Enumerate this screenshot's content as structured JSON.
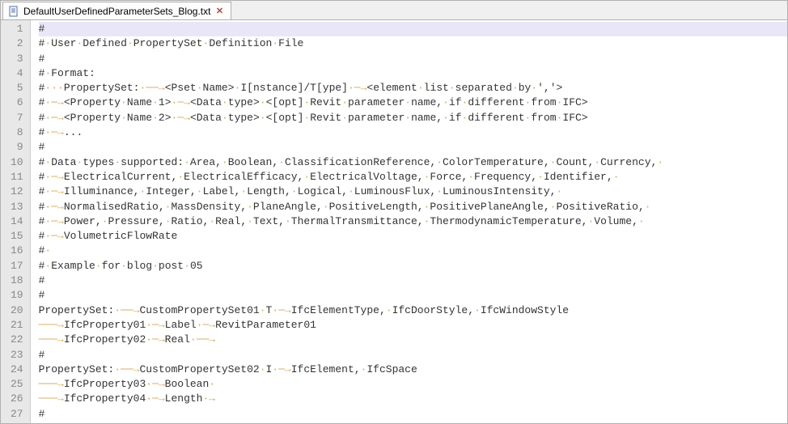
{
  "tab": {
    "filename": "DefaultUserDefinedParameterSets_Blog.txt"
  },
  "editor": {
    "current_line": 1,
    "tab_width_chars": 4,
    "lines": [
      [
        {
          "t": "text",
          "v": "#"
        }
      ],
      [
        {
          "t": "text",
          "v": "#"
        },
        {
          "t": "sp"
        },
        {
          "t": "text",
          "v": "User"
        },
        {
          "t": "sp"
        },
        {
          "t": "text",
          "v": "Defined"
        },
        {
          "t": "sp"
        },
        {
          "t": "text",
          "v": "PropertySet"
        },
        {
          "t": "sp"
        },
        {
          "t": "text",
          "v": "Definition"
        },
        {
          "t": "sp"
        },
        {
          "t": "text",
          "v": "File"
        }
      ],
      [
        {
          "t": "text",
          "v": "#"
        }
      ],
      [
        {
          "t": "text",
          "v": "#"
        },
        {
          "t": "sp"
        },
        {
          "t": "text",
          "v": "Format:"
        }
      ],
      [
        {
          "t": "text",
          "v": "#"
        },
        {
          "t": "sp"
        },
        {
          "t": "sp"
        },
        {
          "t": "sp"
        },
        {
          "t": "text",
          "v": "PropertySet:"
        },
        {
          "t": "sp"
        },
        {
          "t": "tab"
        },
        {
          "t": "text",
          "v": "<Pset"
        },
        {
          "t": "sp"
        },
        {
          "t": "text",
          "v": "Name>"
        },
        {
          "t": "sp"
        },
        {
          "t": "text",
          "v": "I[nstance]/T[ype]"
        },
        {
          "t": "sp"
        },
        {
          "t": "tab"
        },
        {
          "t": "text",
          "v": "<element"
        },
        {
          "t": "sp"
        },
        {
          "t": "text",
          "v": "list"
        },
        {
          "t": "sp"
        },
        {
          "t": "text",
          "v": "separated"
        },
        {
          "t": "sp"
        },
        {
          "t": "text",
          "v": "by"
        },
        {
          "t": "sp"
        },
        {
          "t": "text",
          "v": "','>"
        }
      ],
      [
        {
          "t": "text",
          "v": "#"
        },
        {
          "t": "sp"
        },
        {
          "t": "tab"
        },
        {
          "t": "text",
          "v": "<Property"
        },
        {
          "t": "sp"
        },
        {
          "t": "text",
          "v": "Name"
        },
        {
          "t": "sp"
        },
        {
          "t": "text",
          "v": "1>"
        },
        {
          "t": "sp"
        },
        {
          "t": "tab"
        },
        {
          "t": "text",
          "v": "<Data"
        },
        {
          "t": "sp"
        },
        {
          "t": "text",
          "v": "type>"
        },
        {
          "t": "sp"
        },
        {
          "t": "text",
          "v": "<[opt]"
        },
        {
          "t": "sp"
        },
        {
          "t": "text",
          "v": "Revit"
        },
        {
          "t": "sp"
        },
        {
          "t": "text",
          "v": "parameter"
        },
        {
          "t": "sp"
        },
        {
          "t": "text",
          "v": "name,"
        },
        {
          "t": "sp"
        },
        {
          "t": "text",
          "v": "if"
        },
        {
          "t": "sp"
        },
        {
          "t": "text",
          "v": "different"
        },
        {
          "t": "sp"
        },
        {
          "t": "text",
          "v": "from"
        },
        {
          "t": "sp"
        },
        {
          "t": "text",
          "v": "IFC>"
        }
      ],
      [
        {
          "t": "text",
          "v": "#"
        },
        {
          "t": "sp"
        },
        {
          "t": "tab"
        },
        {
          "t": "text",
          "v": "<Property"
        },
        {
          "t": "sp"
        },
        {
          "t": "text",
          "v": "Name"
        },
        {
          "t": "sp"
        },
        {
          "t": "text",
          "v": "2>"
        },
        {
          "t": "sp"
        },
        {
          "t": "tab"
        },
        {
          "t": "text",
          "v": "<Data"
        },
        {
          "t": "sp"
        },
        {
          "t": "text",
          "v": "type>"
        },
        {
          "t": "sp"
        },
        {
          "t": "text",
          "v": "<[opt]"
        },
        {
          "t": "sp"
        },
        {
          "t": "text",
          "v": "Revit"
        },
        {
          "t": "sp"
        },
        {
          "t": "text",
          "v": "parameter"
        },
        {
          "t": "sp"
        },
        {
          "t": "text",
          "v": "name,"
        },
        {
          "t": "sp"
        },
        {
          "t": "text",
          "v": "if"
        },
        {
          "t": "sp"
        },
        {
          "t": "text",
          "v": "different"
        },
        {
          "t": "sp"
        },
        {
          "t": "text",
          "v": "from"
        },
        {
          "t": "sp"
        },
        {
          "t": "text",
          "v": "IFC>"
        }
      ],
      [
        {
          "t": "text",
          "v": "#"
        },
        {
          "t": "sp"
        },
        {
          "t": "tab"
        },
        {
          "t": "text",
          "v": "..."
        }
      ],
      [
        {
          "t": "text",
          "v": "#"
        }
      ],
      [
        {
          "t": "text",
          "v": "#"
        },
        {
          "t": "sp"
        },
        {
          "t": "text",
          "v": "Data"
        },
        {
          "t": "sp"
        },
        {
          "t": "text",
          "v": "types"
        },
        {
          "t": "sp"
        },
        {
          "t": "text",
          "v": "supported:"
        },
        {
          "t": "sp"
        },
        {
          "t": "text",
          "v": "Area,"
        },
        {
          "t": "sp"
        },
        {
          "t": "text",
          "v": "Boolean,"
        },
        {
          "t": "sp"
        },
        {
          "t": "text",
          "v": "ClassificationReference,"
        },
        {
          "t": "sp"
        },
        {
          "t": "text",
          "v": "ColorTemperature,"
        },
        {
          "t": "sp"
        },
        {
          "t": "text",
          "v": "Count,"
        },
        {
          "t": "sp"
        },
        {
          "t": "text",
          "v": "Currency,"
        },
        {
          "t": "sp"
        }
      ],
      [
        {
          "t": "text",
          "v": "#"
        },
        {
          "t": "sp"
        },
        {
          "t": "tab"
        },
        {
          "t": "text",
          "v": "ElectricalCurrent,"
        },
        {
          "t": "sp"
        },
        {
          "t": "text",
          "v": "ElectricalEfficacy,"
        },
        {
          "t": "sp"
        },
        {
          "t": "text",
          "v": "ElectricalVoltage,"
        },
        {
          "t": "sp"
        },
        {
          "t": "text",
          "v": "Force,"
        },
        {
          "t": "sp"
        },
        {
          "t": "text",
          "v": "Frequency,"
        },
        {
          "t": "sp"
        },
        {
          "t": "text",
          "v": "Identifier,"
        },
        {
          "t": "sp"
        }
      ],
      [
        {
          "t": "text",
          "v": "#"
        },
        {
          "t": "sp"
        },
        {
          "t": "tab"
        },
        {
          "t": "text",
          "v": "Illuminance,"
        },
        {
          "t": "sp"
        },
        {
          "t": "text",
          "v": "Integer,"
        },
        {
          "t": "sp"
        },
        {
          "t": "text",
          "v": "Label,"
        },
        {
          "t": "sp"
        },
        {
          "t": "text",
          "v": "Length,"
        },
        {
          "t": "sp"
        },
        {
          "t": "text",
          "v": "Logical,"
        },
        {
          "t": "sp"
        },
        {
          "t": "text",
          "v": "LuminousFlux,"
        },
        {
          "t": "sp"
        },
        {
          "t": "text",
          "v": "LuminousIntensity,"
        },
        {
          "t": "sp"
        }
      ],
      [
        {
          "t": "text",
          "v": "#"
        },
        {
          "t": "sp"
        },
        {
          "t": "tab"
        },
        {
          "t": "text",
          "v": "NormalisedRatio,"
        },
        {
          "t": "sp"
        },
        {
          "t": "text",
          "v": "MassDensity,"
        },
        {
          "t": "sp"
        },
        {
          "t": "text",
          "v": "PlaneAngle,"
        },
        {
          "t": "sp"
        },
        {
          "t": "text",
          "v": "PositiveLength,"
        },
        {
          "t": "sp"
        },
        {
          "t": "text",
          "v": "PositivePlaneAngle,"
        },
        {
          "t": "sp"
        },
        {
          "t": "text",
          "v": "PositiveRatio,"
        },
        {
          "t": "sp"
        }
      ],
      [
        {
          "t": "text",
          "v": "#"
        },
        {
          "t": "sp"
        },
        {
          "t": "tab"
        },
        {
          "t": "text",
          "v": "Power,"
        },
        {
          "t": "sp"
        },
        {
          "t": "text",
          "v": "Pressure,"
        },
        {
          "t": "sp"
        },
        {
          "t": "text",
          "v": "Ratio,"
        },
        {
          "t": "sp"
        },
        {
          "t": "text",
          "v": "Real,"
        },
        {
          "t": "sp"
        },
        {
          "t": "text",
          "v": "Text,"
        },
        {
          "t": "sp"
        },
        {
          "t": "text",
          "v": "ThermalTransmittance,"
        },
        {
          "t": "sp"
        },
        {
          "t": "text",
          "v": "ThermodynamicTemperature,"
        },
        {
          "t": "sp"
        },
        {
          "t": "text",
          "v": "Volume,"
        },
        {
          "t": "sp"
        }
      ],
      [
        {
          "t": "text",
          "v": "#"
        },
        {
          "t": "sp"
        },
        {
          "t": "tab"
        },
        {
          "t": "text",
          "v": "VolumetricFlowRate"
        }
      ],
      [
        {
          "t": "text",
          "v": "#"
        },
        {
          "t": "sp"
        }
      ],
      [
        {
          "t": "text",
          "v": "#"
        },
        {
          "t": "sp"
        },
        {
          "t": "text",
          "v": "Example"
        },
        {
          "t": "sp"
        },
        {
          "t": "text",
          "v": "for"
        },
        {
          "t": "sp"
        },
        {
          "t": "text",
          "v": "blog"
        },
        {
          "t": "sp"
        },
        {
          "t": "text",
          "v": "post"
        },
        {
          "t": "sp"
        },
        {
          "t": "text",
          "v": "05"
        }
      ],
      [
        {
          "t": "text",
          "v": "#"
        }
      ],
      [
        {
          "t": "text",
          "v": "#"
        }
      ],
      [
        {
          "t": "text",
          "v": "PropertySet:"
        },
        {
          "t": "sp"
        },
        {
          "t": "tab"
        },
        {
          "t": "text",
          "v": "CustomPropertySet01"
        },
        {
          "t": "sp"
        },
        {
          "t": "text",
          "v": "T"
        },
        {
          "t": "sp"
        },
        {
          "t": "tab"
        },
        {
          "t": "text",
          "v": "IfcElementType,"
        },
        {
          "t": "sp"
        },
        {
          "t": "text",
          "v": "IfcDoorStyle,"
        },
        {
          "t": "sp"
        },
        {
          "t": "text",
          "v": "IfcWindowStyle"
        }
      ],
      [
        {
          "t": "tab"
        },
        {
          "t": "text",
          "v": "IfcProperty01"
        },
        {
          "t": "sp"
        },
        {
          "t": "tab"
        },
        {
          "t": "text",
          "v": "Label"
        },
        {
          "t": "sp"
        },
        {
          "t": "tab"
        },
        {
          "t": "text",
          "v": "RevitParameter01"
        }
      ],
      [
        {
          "t": "tab"
        },
        {
          "t": "text",
          "v": "IfcProperty02"
        },
        {
          "t": "sp"
        },
        {
          "t": "tab"
        },
        {
          "t": "text",
          "v": "Real"
        },
        {
          "t": "sp"
        },
        {
          "t": "tab"
        }
      ],
      [
        {
          "t": "text",
          "v": "#"
        }
      ],
      [
        {
          "t": "text",
          "v": "PropertySet:"
        },
        {
          "t": "sp"
        },
        {
          "t": "tab"
        },
        {
          "t": "text",
          "v": "CustomPropertySet02"
        },
        {
          "t": "sp"
        },
        {
          "t": "text",
          "v": "I"
        },
        {
          "t": "sp"
        },
        {
          "t": "tab"
        },
        {
          "t": "text",
          "v": "IfcElement,"
        },
        {
          "t": "sp"
        },
        {
          "t": "text",
          "v": "IfcSpace"
        }
      ],
      [
        {
          "t": "tab"
        },
        {
          "t": "text",
          "v": "IfcProperty03"
        },
        {
          "t": "sp"
        },
        {
          "t": "tab"
        },
        {
          "t": "text",
          "v": "Boolean"
        },
        {
          "t": "sp"
        }
      ],
      [
        {
          "t": "tab"
        },
        {
          "t": "text",
          "v": "IfcProperty04"
        },
        {
          "t": "sp"
        },
        {
          "t": "tab"
        },
        {
          "t": "text",
          "v": "Length"
        },
        {
          "t": "sp"
        },
        {
          "t": "tab"
        }
      ],
      [
        {
          "t": "text",
          "v": "#"
        }
      ]
    ]
  }
}
